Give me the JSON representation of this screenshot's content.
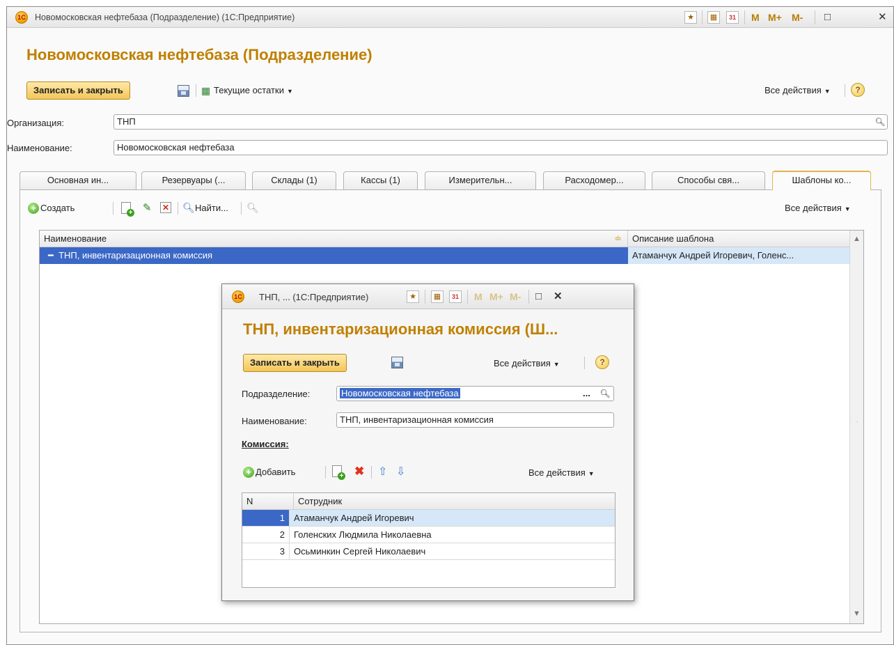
{
  "main_window": {
    "title": "Новомосковская нефтебаза (Подразделение) (1С:Предприятие)",
    "heading": "Новомосковская нефтебаза (Подразделение)",
    "logo": "1C",
    "titlebar_icons": [
      "favorite-icon",
      "calculator-icon",
      "calendar-icon"
    ],
    "calendar_label": "31",
    "memory_buttons": [
      "M",
      "M+",
      "M-"
    ],
    "window_controls": [
      "□",
      "✕"
    ],
    "toolbar": {
      "save_close": "Записать и закрыть",
      "stock": "Текущие остатки",
      "all_actions": "Все действия",
      "help": "?"
    },
    "fields": {
      "organization_label": "Организация:",
      "organization_value": "ТНП",
      "name_label": "Наименование:",
      "name_value": "Новомосковская нефтебаза"
    },
    "tabs": [
      "Основная ин...",
      "Резервуары (...",
      "Склады (1)",
      "Кассы (1)",
      "Измерительн...",
      "Расходомер...",
      "Способы свя...",
      "Шаблоны ко..."
    ],
    "active_tab_index": 7,
    "list_toolbar": {
      "create": "Создать",
      "find": "Найти...",
      "all_actions": "Все действия"
    },
    "grid": {
      "columns": [
        "Наименование",
        "Описание шаблона"
      ],
      "rows": [
        {
          "name": "ТНП, инвентаризационная комиссия",
          "description": "Атаманчук Андрей Игоревич, Голенс..."
        }
      ]
    }
  },
  "popup_window": {
    "title": "ТНП, ... (1С:Предприятие)",
    "heading": "ТНП, инвентаризационная комиссия (Ш...",
    "toolbar": {
      "save_close": "Записать и закрыть",
      "all_actions": "Все действия",
      "help": "?"
    },
    "fields": {
      "department_label": "Подразделение:",
      "department_value": "Новомосковская нефтебаза",
      "department_more": "...",
      "name_label": "Наименование:",
      "name_value": "ТНП, инвентаризационная комиссия"
    },
    "commission_label": "Комиссия:",
    "table_toolbar": {
      "add": "Добавить",
      "all_actions": "Все действия"
    },
    "table": {
      "columns": [
        "N",
        "Сотрудник"
      ],
      "rows": [
        {
          "n": "1",
          "employee": "Атаманчук Андрей Игоревич"
        },
        {
          "n": "2",
          "employee": "Голенских Людмила Николаевна"
        },
        {
          "n": "3",
          "employee": "Осьминкин Сергей Николаевич"
        }
      ]
    }
  }
}
